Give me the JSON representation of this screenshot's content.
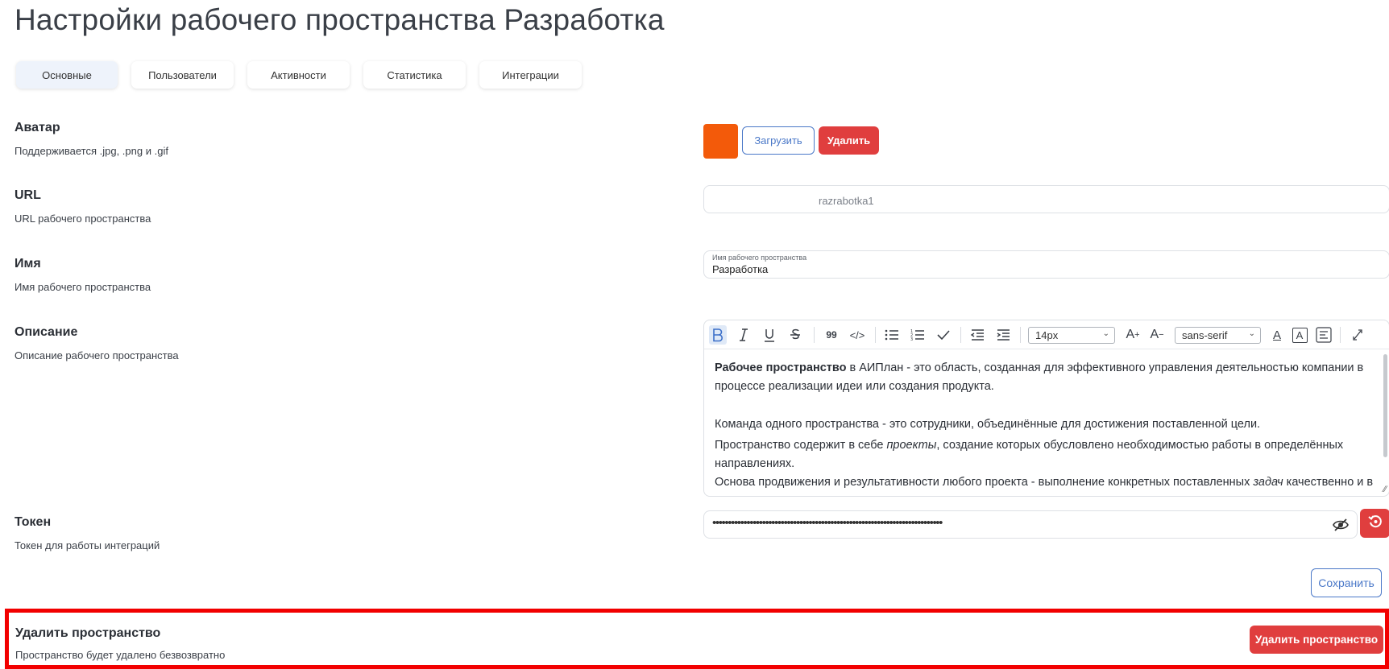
{
  "page": {
    "title": "Настройки рабочего пространства Разработка"
  },
  "tabs": [
    {
      "label": "Основные",
      "active": true
    },
    {
      "label": "Пользователи",
      "active": false
    },
    {
      "label": "Активности",
      "active": false
    },
    {
      "label": "Статистика",
      "active": false
    },
    {
      "label": "Интеграции",
      "active": false
    }
  ],
  "avatar": {
    "label": "Аватар",
    "hint": "Поддерживается .jpg, .png и .gif",
    "color": "#f35a0a",
    "upload_label": "Загрузить",
    "delete_label": "Удалить"
  },
  "url": {
    "label": "URL",
    "hint": "URL рабочего пространства",
    "value": "razrabotka1"
  },
  "name": {
    "label": "Имя",
    "hint": "Имя рабочего пространства",
    "field_label": "Имя рабочего пространства",
    "value": "Разработка"
  },
  "description": {
    "label": "Описание",
    "hint": "Описание рабочего пространства",
    "toolbar": {
      "font_size": "14px",
      "font_family": "sans-serif",
      "buttons": [
        "bold-icon",
        "italic-icon",
        "underline-icon",
        "strikethrough-icon",
        "quote-icon",
        "code-icon",
        "bullet-list-icon",
        "numbered-list-icon",
        "checklist-icon",
        "outdent-icon",
        "indent-icon",
        "font-size-increase-icon",
        "font-size-decrease-icon",
        "text-color-icon",
        "highlight-color-icon",
        "align-icon",
        "link-icon"
      ]
    },
    "content": {
      "p1_bold": "Рабочее пространство",
      "p1_rest": " в АИПлан - это область, созданная для эффективного управления деятельностью компании в процессе реализации идеи или создания продукта.",
      "p2": "Команда одного пространства - это сотрудники, объединённые для достижения поставленной цели.",
      "p3_start": "Пространство содержит в себе ",
      "p3_italic": "проекты",
      "p3_end": ", создание которых обусловлено необходимостью работы в определённых направлениях.",
      "p4_start": "Основа продвижения и результативности любого проекта - выполнение конкретных поставленных ",
      "p4_italic": "задач",
      "p4_end": " качественно и в"
    }
  },
  "token": {
    "label": "Токен",
    "hint": "Токен для работы интеграций",
    "masked_value": "••••••••••••••••••••••••••••••••••••••••••••••••••••••••••••••••••••••••••"
  },
  "save_label": "Сохранить",
  "delete_space": {
    "title": "Удалить пространство",
    "hint": "Пространство будет удалено безвозвратно",
    "button_label": "Удалить пространство",
    "highlight_color": "#f20000"
  },
  "colors": {
    "accent": "#4a78c8",
    "danger": "#e03e3e"
  }
}
